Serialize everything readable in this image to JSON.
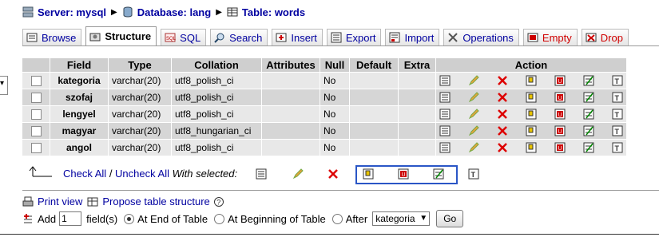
{
  "breadcrumb": {
    "server": "Server: mysql",
    "database": "Database: lang",
    "table": "Table: words"
  },
  "tabs": [
    {
      "label": "Browse",
      "icon": "browse-icon"
    },
    {
      "label": "Structure",
      "icon": "structure-icon",
      "active": true
    },
    {
      "label": "SQL",
      "icon": "sql-icon"
    },
    {
      "label": "Search",
      "icon": "search-icon"
    },
    {
      "label": "Insert",
      "icon": "insert-icon"
    },
    {
      "label": "Export",
      "icon": "export-icon"
    },
    {
      "label": "Import",
      "icon": "import-icon"
    },
    {
      "label": "Operations",
      "icon": "operations-icon"
    },
    {
      "label": "Empty",
      "icon": "empty-icon",
      "danger": true
    },
    {
      "label": "Drop",
      "icon": "drop-icon",
      "danger": true
    }
  ],
  "table": {
    "headers": [
      "Field",
      "Type",
      "Collation",
      "Attributes",
      "Null",
      "Default",
      "Extra",
      "Action"
    ],
    "rows": [
      {
        "field": "kategoria",
        "type": "varchar(20)",
        "collation": "utf8_polish_ci",
        "attributes": "",
        "null": "No",
        "default": "",
        "extra": ""
      },
      {
        "field": "szofaj",
        "type": "varchar(20)",
        "collation": "utf8_polish_ci",
        "attributes": "",
        "null": "No",
        "default": "",
        "extra": ""
      },
      {
        "field": "lengyel",
        "type": "varchar(20)",
        "collation": "utf8_polish_ci",
        "attributes": "",
        "null": "No",
        "default": "",
        "extra": ""
      },
      {
        "field": "magyar",
        "type": "varchar(20)",
        "collation": "utf8_hungarian_ci",
        "attributes": "",
        "null": "No",
        "default": "",
        "extra": ""
      },
      {
        "field": "angol",
        "type": "varchar(20)",
        "collation": "utf8_polish_ci",
        "attributes": "",
        "null": "No",
        "default": "",
        "extra": ""
      }
    ]
  },
  "with_selected": {
    "check_all": "Check All",
    "slash": " / ",
    "uncheck_all": "Uncheck All",
    "label": "With selected:"
  },
  "links": {
    "print_view": "Print view",
    "propose": "Propose table structure"
  },
  "add_fields": {
    "add_label": "Add",
    "count": "1",
    "fields_label": "field(s)",
    "opt_end": "At End of Table",
    "opt_begin": "At Beginning of Table",
    "opt_after": "After",
    "after_value": "kategoria",
    "go": "Go"
  },
  "colors": {
    "link": "#0000a0",
    "danger": "#d00000",
    "header_bg": "#cfcfcf",
    "row_odd": "#e8e8e8",
    "row_even": "#d6d6d6",
    "select_border": "#2a56c6"
  }
}
